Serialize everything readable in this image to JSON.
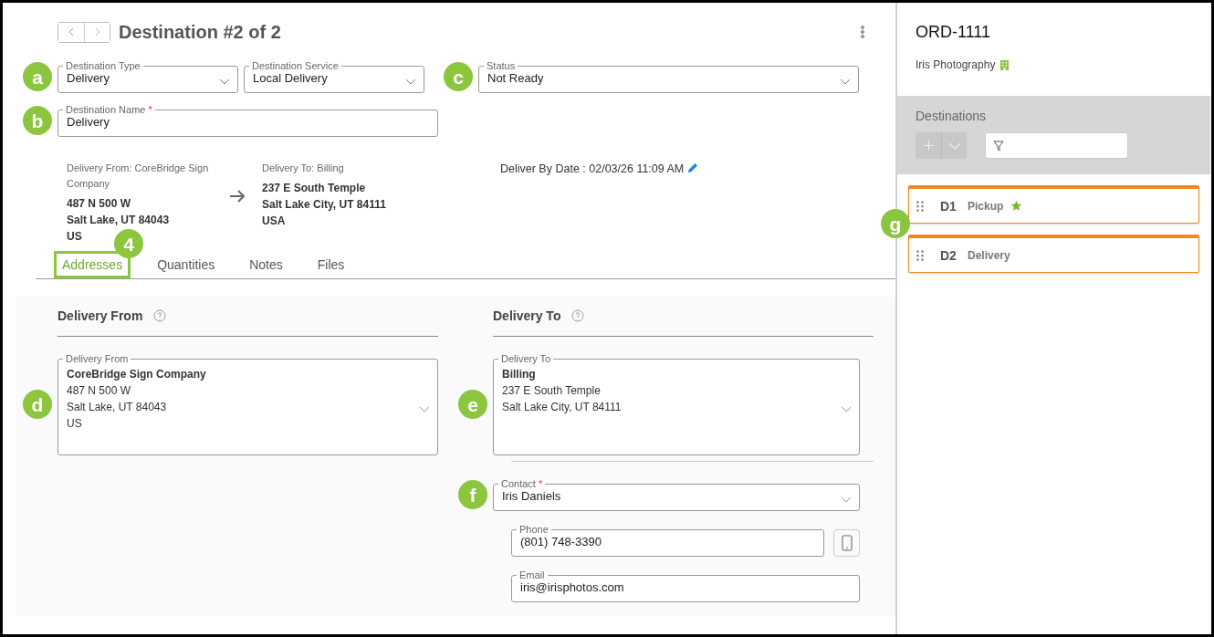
{
  "header": {
    "title": "Destination #2 of 2"
  },
  "destination_type": {
    "label": "Destination Type",
    "value": "Delivery",
    "callout": "a"
  },
  "destination_service": {
    "label": "Destination Service",
    "value": "Local Delivery"
  },
  "status": {
    "label": "Status",
    "value": "Not Ready",
    "callout": "c"
  },
  "destination_name": {
    "label": "Destination Name",
    "required_mark": "*",
    "value": "Delivery",
    "callout": "b"
  },
  "summary": {
    "from_title": "Delivery From: CoreBridge Sign Company",
    "from_lines": [
      "487 N 500 W",
      "Salt Lake, UT 84043",
      "US"
    ],
    "to_title": "Delivery To: Billing",
    "to_lines": [
      "237 E South Temple",
      "Salt Lake City, UT 84111",
      "USA"
    ],
    "deliver_by": "Deliver By Date : 02/03/26 11:09 AM"
  },
  "tabs": [
    {
      "label": "Addresses",
      "selected": true,
      "highlighted": true,
      "callout": "4"
    },
    {
      "label": "Quantities",
      "selected": false,
      "highlighted": false
    },
    {
      "label": "Notes",
      "selected": false,
      "highlighted": false
    },
    {
      "label": "Files",
      "selected": false,
      "highlighted": false
    }
  ],
  "delivery_from": {
    "heading": "Delivery From",
    "label": "Delivery From",
    "name": "CoreBridge Sign Company",
    "lines": [
      "487 N 500 W",
      "Salt Lake, UT 84043",
      "US"
    ],
    "callout": "d"
  },
  "delivery_to": {
    "heading": "Delivery To",
    "label": "Delivery To",
    "name": "Billing",
    "lines": [
      "237 E South Temple",
      "Salt Lake City, UT 84111"
    ],
    "callout": "e"
  },
  "contact": {
    "label": "Contact",
    "required_mark": "*",
    "value": "Iris Daniels",
    "callout": "f"
  },
  "phone": {
    "label": "Phone",
    "value": "(801) 748-3390"
  },
  "email": {
    "label": "Email",
    "value": "iris@irisphotos.com"
  },
  "sidebar": {
    "order": "ORD-1111",
    "company": "Iris Photography",
    "destinations_title": "Destinations",
    "callout": "g",
    "destinations": [
      {
        "code": "D1",
        "type": "Pickup",
        "starred": true
      },
      {
        "code": "D2",
        "type": "Delivery",
        "starred": false
      }
    ]
  }
}
